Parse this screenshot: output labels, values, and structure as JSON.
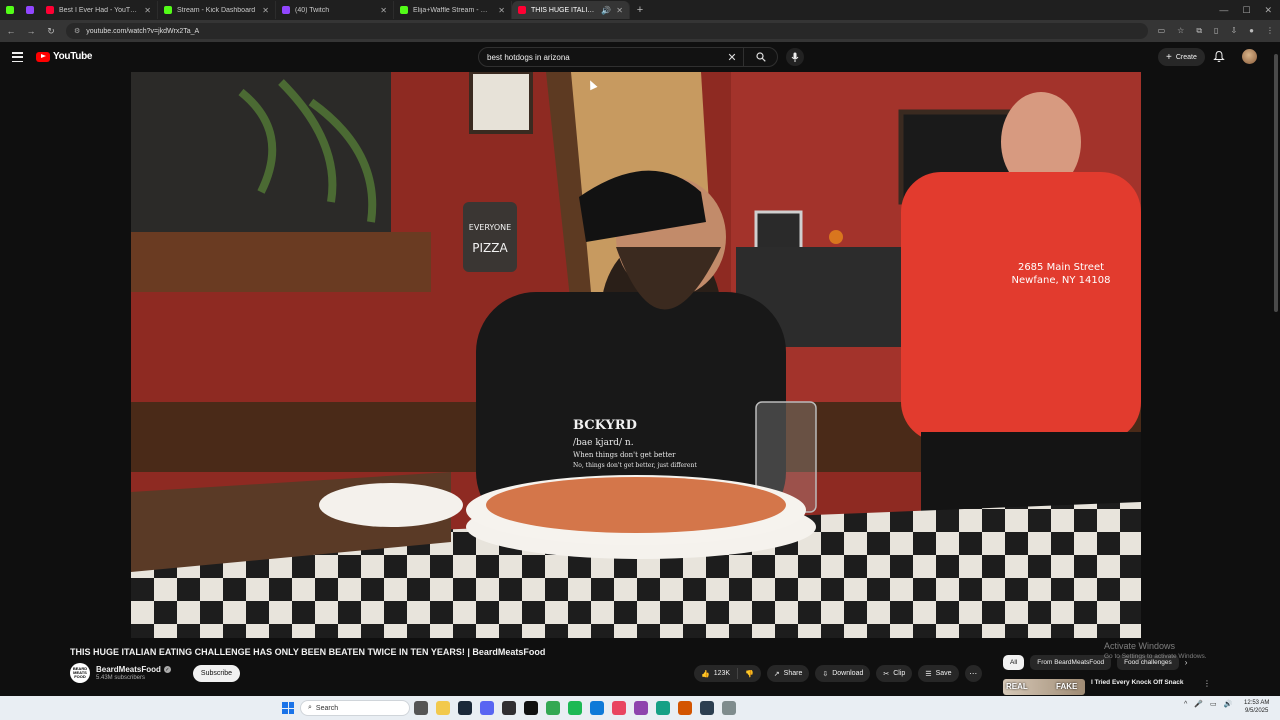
{
  "browser": {
    "tabs": [
      {
        "title": "Best I Ever Had - YouTube",
        "favicon_color": "#ff0033",
        "active": false
      },
      {
        "title": "Stream - Kick Dashboard",
        "favicon_color": "#53fc18",
        "active": false
      },
      {
        "title": "(40) Twitch",
        "favicon_color": "#9146ff",
        "active": false
      },
      {
        "title": "Elija+Waffle Stream - Watch Li...",
        "favicon_color": "#53fc18",
        "active": false
      },
      {
        "title": "THIS HUGE ITALIAN EATIN...",
        "favicon_color": "#ff0033",
        "active": true
      }
    ],
    "url": "youtube.com/watch?v=jkdWrx2Ta_A"
  },
  "youtube": {
    "logo_text": "YouTube",
    "search_query": "best hotdogs in arizona",
    "create_label": "Create"
  },
  "video": {
    "title": "THIS HUGE ITALIAN EATING CHALLENGE HAS ONLY BEEN BEATEN TWICE IN TEN YEARS! | BeardMeatsFood",
    "shirt_text_1": "BCKYRD",
    "shirt_text_2": "/bae kjard/ n.",
    "shirt_text_3": "When things don't get better",
    "shirt_text_4": "No, things don't get better, just different",
    "tshirt_line_1": "2685 Main Street",
    "tshirt_line_2": "Newfane, NY 14108",
    "sign_text_1": "EVERYONE",
    "sign_text_2": "PIZZA"
  },
  "channel": {
    "name": "BeardMeatsFood",
    "subscribers": "5.43M subscribers",
    "avatar_text": "BEARD MEATS FOOD",
    "subscribe_label": "Subscribe"
  },
  "actions": {
    "likes": "123K",
    "share": "Share",
    "download": "Download",
    "clip": "Clip",
    "save": "Save"
  },
  "chips": [
    "All",
    "From BeardMeatsFood",
    "Food challenges"
  ],
  "recommendation": {
    "title": "I Tried Every Knock Off Snack",
    "thumb_left": "REAL",
    "thumb_right": "FAKE"
  },
  "watermark": {
    "line1": "Activate Windows",
    "line2": "Go to Settings to activate Windows."
  },
  "taskbar": {
    "search_placeholder": "Search",
    "time": "12:53 AM",
    "date": "9/5/2025"
  },
  "colors": {
    "yt_red": "#ff0000",
    "page_bg": "#0f0f0f",
    "wall_red": "#8e2a22",
    "shirt_red": "#e23b2e"
  }
}
